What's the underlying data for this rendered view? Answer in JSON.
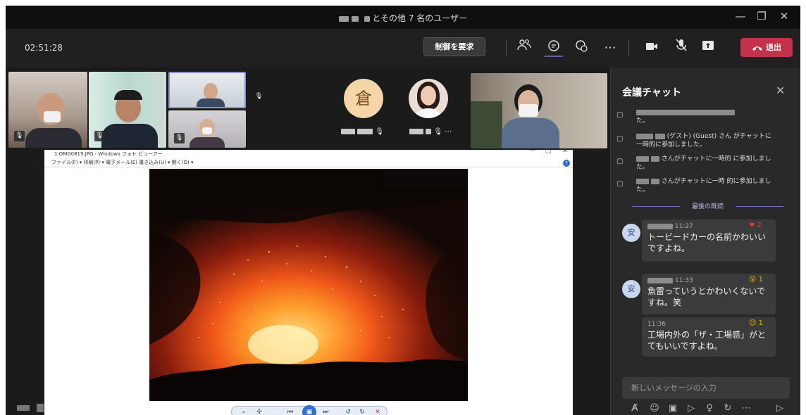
{
  "window": {
    "title": "とその他 7 名のユーザー",
    "minimize": "—",
    "restore": "❐",
    "close": "✕"
  },
  "meeting": {
    "timer": "02:51:28",
    "request_control": "制御を要求",
    "leave": "退出",
    "more": "⋯"
  },
  "participants": {
    "avatar1": {
      "glyph": "倉",
      "color": "#f4d6a8",
      "text_color": "#7a4a18"
    },
    "mic_muted_icon": "🎙",
    "overflow": "⋯"
  },
  "viewer": {
    "title": "1 OMG0819.JPG - Windows フォト ビューアー",
    "menu": "ファイル(F) ▾   印刷(P) ▾   電子メール(E)   書き込み(U) ▾   開く(O) ▾",
    "min": "—",
    "max": "□",
    "close": "✕",
    "help": "?"
  },
  "chat": {
    "title": "会議チャット",
    "close": "✕",
    "system_messages": [
      "た。",
      "(ゲスト) (Guest) さん がチャットに一時的に参加しました。",
      "さんがチャットに一時的 に参加しました。",
      "さんがチャットに一時 的に参加しました。"
    ],
    "last_read": "最後の既読",
    "messages": [
      {
        "avatar": "安",
        "time": "11:27",
        "text": "トービードカーの名前かわいいですよね。",
        "reaction": "❤ 2",
        "reaction_color": "#e23b3b"
      },
      {
        "avatar": "安",
        "time": "11:33",
        "text": "魚雷っていうとかわいくないですね。笑",
        "reaction": "😮 1",
        "reaction_color": "#f0b400"
      },
      {
        "avatar": "",
        "time": "11:36",
        "text": "工場内外の「ザ・工場感」がとてもいいですよね。",
        "reaction": "😊 1",
        "reaction_color": "#f0b400"
      }
    ],
    "compose_placeholder": "新しいメッセージの入力",
    "compose_icons": [
      "format-icon",
      "emoji-icon",
      "gif-icon",
      "sticker-icon",
      "praise-icon",
      "loop-icon",
      "more-icon",
      "send-icon"
    ],
    "send": "▷"
  },
  "colors": {
    "accent": "#6264a7",
    "leave": "#c4314b",
    "background": "#1f1f1f"
  }
}
